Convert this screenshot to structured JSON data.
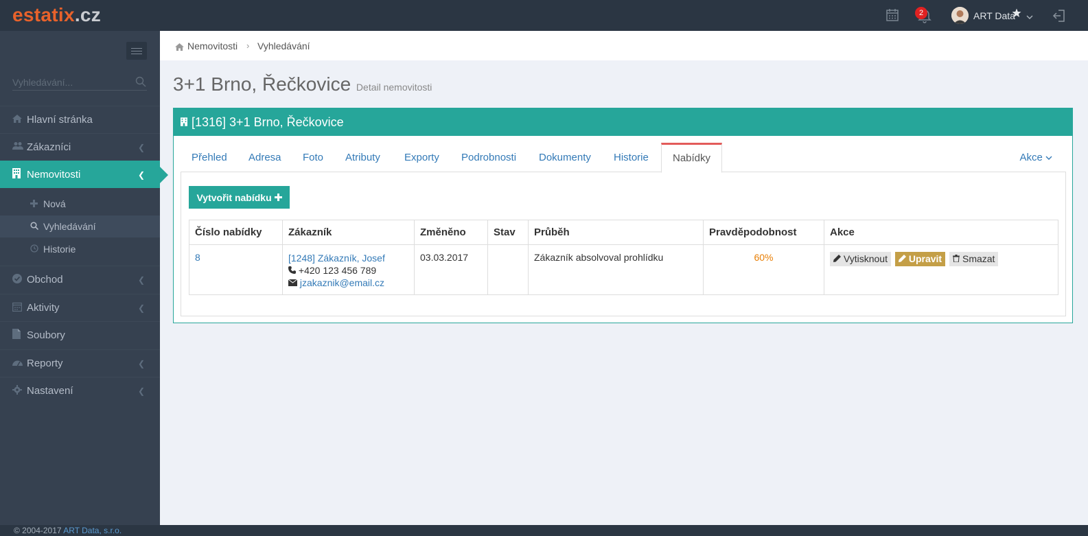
{
  "app": {
    "logo_main": "estatix",
    "logo_tld": ".cz",
    "notification_count": "2",
    "user_name": "ART Data"
  },
  "sidebar": {
    "search_placeholder": "Vyhledávání...",
    "items": [
      {
        "label": "Hlavní stránka",
        "icon": "home-icon"
      },
      {
        "label": "Zákazníci",
        "icon": "users-icon"
      },
      {
        "label": "Nemovitosti",
        "icon": "building-icon"
      },
      {
        "label": "Obchod",
        "icon": "check-circle-icon"
      },
      {
        "label": "Aktivity",
        "icon": "calendar-icon"
      },
      {
        "label": "Soubory",
        "icon": "file-icon"
      },
      {
        "label": "Reporty",
        "icon": "dashboard-icon"
      },
      {
        "label": "Nastavení",
        "icon": "cog-icon"
      }
    ],
    "subitems": [
      {
        "label": "Nová",
        "icon": "plus-icon"
      },
      {
        "label": "Vyhledávání",
        "icon": "search-icon"
      },
      {
        "label": "Historie",
        "icon": "clock-icon"
      }
    ]
  },
  "footer": {
    "copyright": "© 2004-2017 ",
    "company": "ART Data, s.r.o."
  },
  "breadcrumb": {
    "level1": "Nemovitosti",
    "level2": "Vyhledávání"
  },
  "page": {
    "title": "3+1 Brno, Řečkovice",
    "subtitle": "Detail nemovitosti",
    "portlet_title": "[1316] 3+1 Brno, Řečkovice"
  },
  "tabs": [
    "Přehled",
    "Adresa",
    "Foto",
    "Atributy",
    "Exporty",
    "Podrobnosti",
    "Dokumenty",
    "Historie",
    "Nabídky"
  ],
  "tabs_actions_label": "Akce",
  "offers": {
    "create_button": "Vytvořit nabídku",
    "columns": [
      "Číslo nabídky",
      "Zákazník",
      "Změněno",
      "Stav",
      "Průběh",
      "Pravděpodobnost",
      "Akce"
    ],
    "rows": [
      {
        "number": "8",
        "customer_name": "[1248] Zákazník, Josef",
        "customer_phone": "+420 123 456 789",
        "customer_email": "jzakaznik@email.cz",
        "changed": "03.03.2017",
        "state": "",
        "progress": "Zákazník absolvoval prohlídku",
        "probability": "60%",
        "print_label": "Vytisknout",
        "edit_label": "Upravit",
        "delete_label": "Smazat"
      }
    ]
  },
  "colors": {
    "accent": "#26a69a",
    "topbar": "#2b3643",
    "sidebar": "#364150",
    "logo": "#e8622b",
    "probability": "#e87e04",
    "edit_button": "#c49f47"
  }
}
